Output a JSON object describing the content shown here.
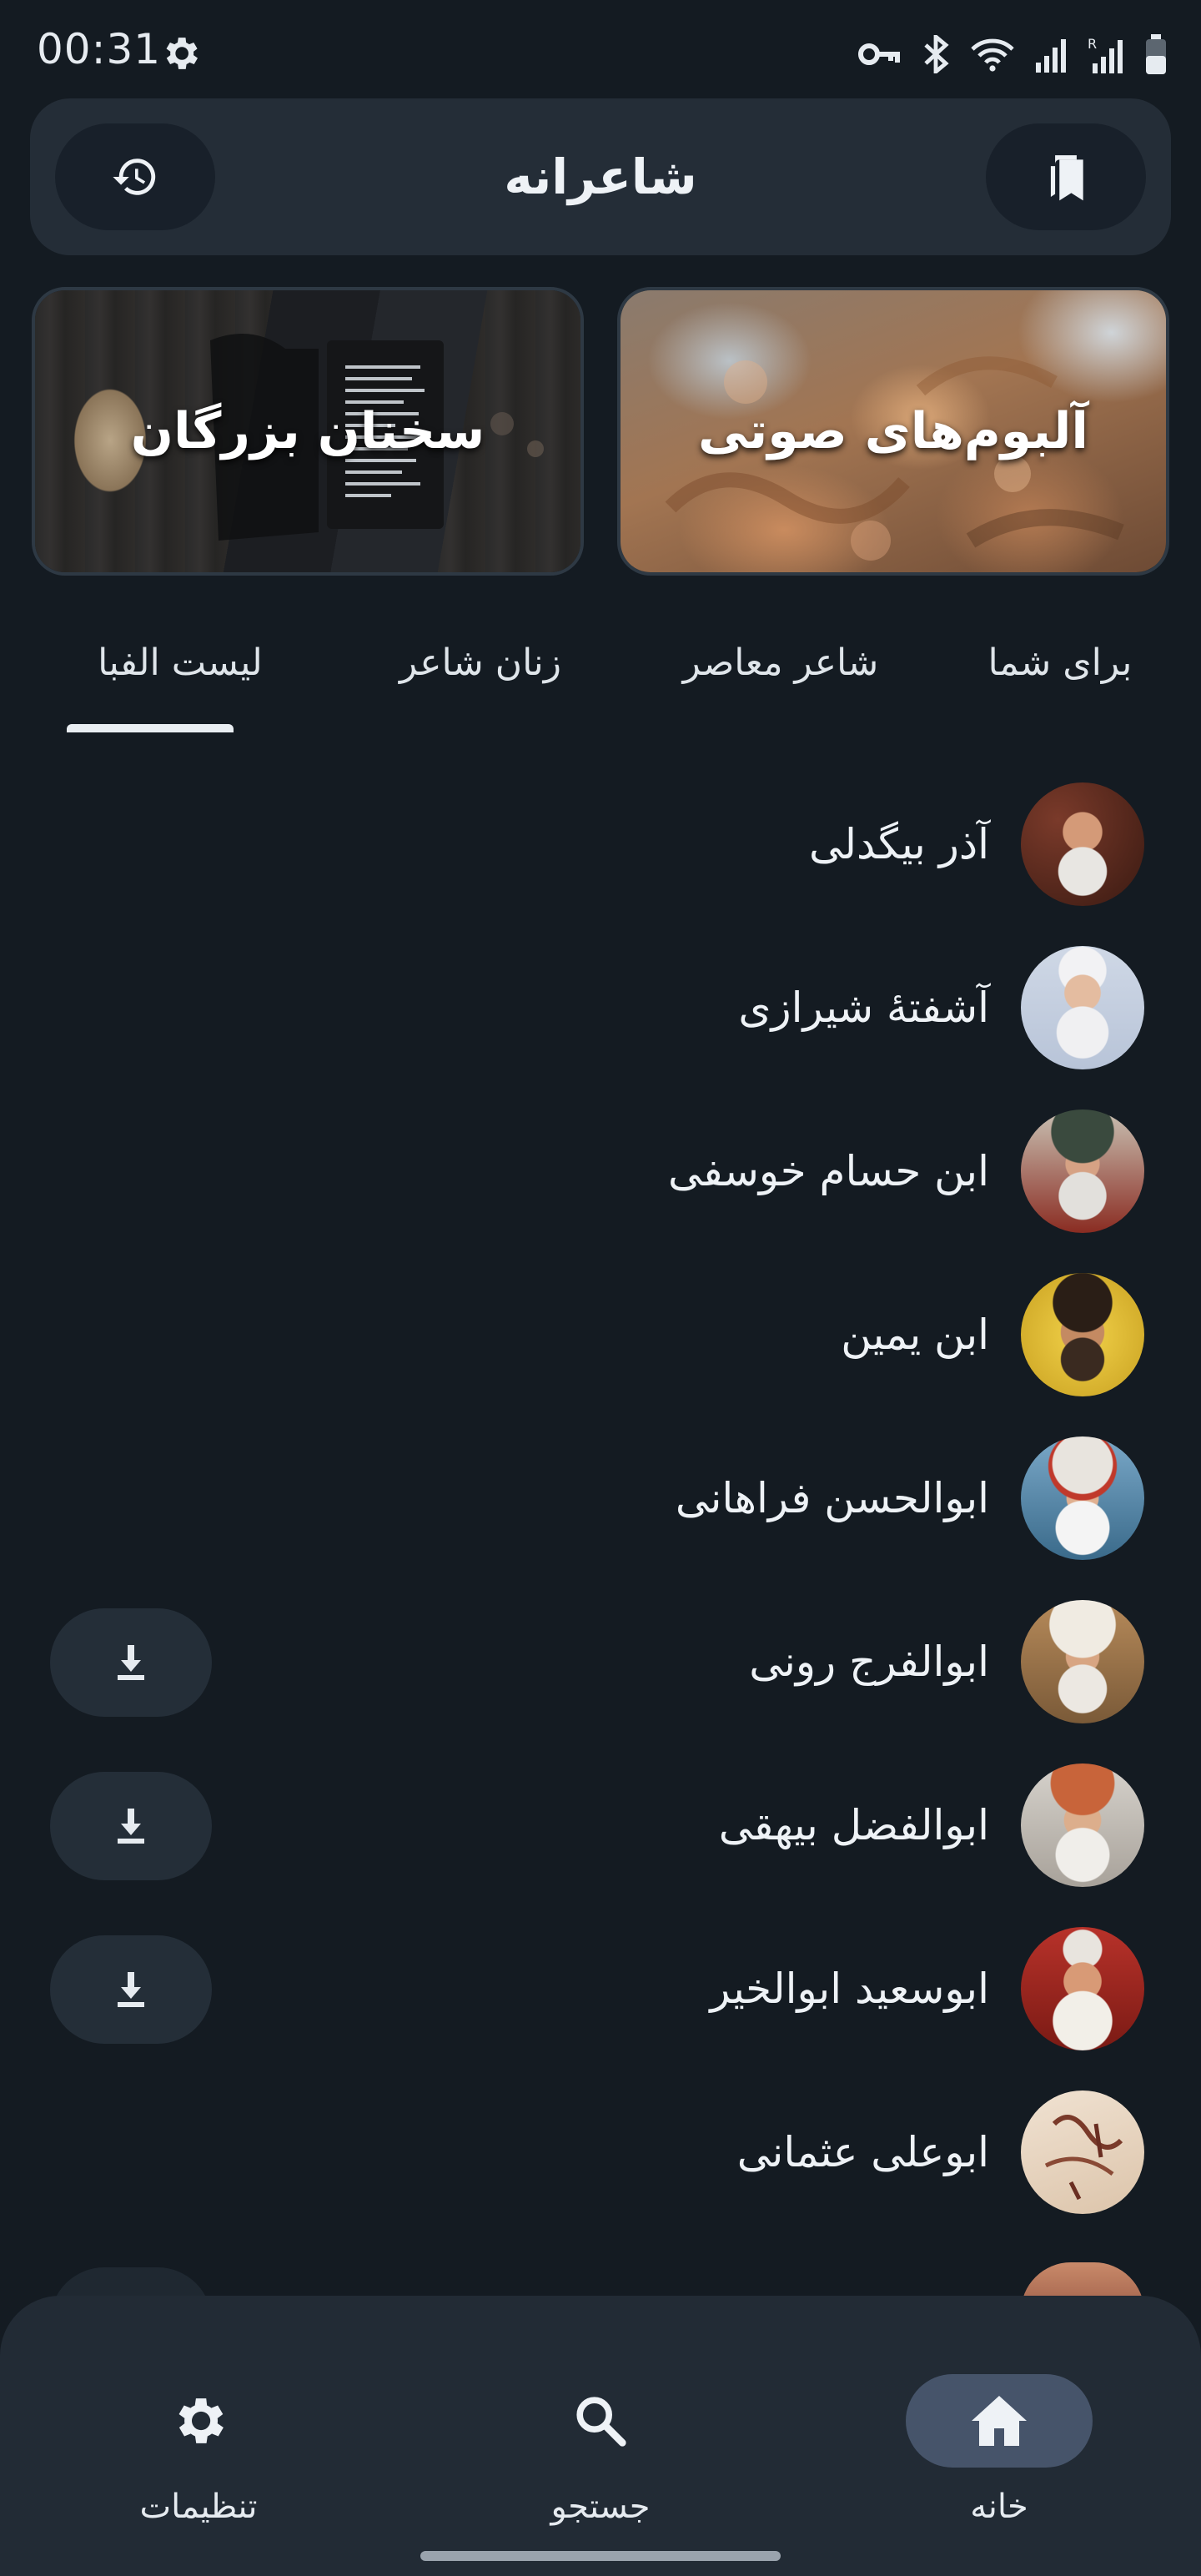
{
  "status_bar": {
    "time": "00:31",
    "icons": [
      "gear-icon",
      "vpn-key-icon",
      "bluetooth-icon",
      "wifi-icon",
      "signal-icon",
      "signal-roaming-icon",
      "battery-icon"
    ]
  },
  "app_bar": {
    "title": "شاعرانه",
    "left_icon": "history-icon",
    "right_icon": "bookmark-icon"
  },
  "cards": {
    "audio_albums": "آلبوم‌های صوتی",
    "great_quotes": "سخنان بزرگان"
  },
  "tabs": [
    {
      "label": "برای شما"
    },
    {
      "label": "شاعر معاصر"
    },
    {
      "label": "زنان شاعر"
    },
    {
      "label": "لیست الفبا",
      "active": true
    }
  ],
  "poets": [
    {
      "name": "آذر بیگدلی",
      "downloadable": false
    },
    {
      "name": "آشفتهٔ شیرازی",
      "downloadable": false
    },
    {
      "name": "ابن حسام خوسفی",
      "downloadable": false
    },
    {
      "name": "ابن یمین",
      "downloadable": false
    },
    {
      "name": "ابوالحسن فراهانی",
      "downloadable": false
    },
    {
      "name": "ابوالفرج رونی",
      "downloadable": true
    },
    {
      "name": "ابوالفضل بیهقی",
      "downloadable": true
    },
    {
      "name": "ابوسعید ابوالخیر",
      "downloadable": true
    },
    {
      "name": "ابوعلی عثمانی",
      "downloadable": false
    }
  ],
  "bottom_nav": [
    {
      "label": "تنظیمات",
      "icon": "settings-icon"
    },
    {
      "label": "جستجو",
      "icon": "search-icon"
    },
    {
      "label": "خانه",
      "icon": "home-icon",
      "active": true
    }
  ],
  "colors": {
    "background": "#141b22",
    "app_bar": "#242d37",
    "nav_active_pill": "#46546a",
    "download_button": "#242e38",
    "text": "#eef2f6"
  }
}
